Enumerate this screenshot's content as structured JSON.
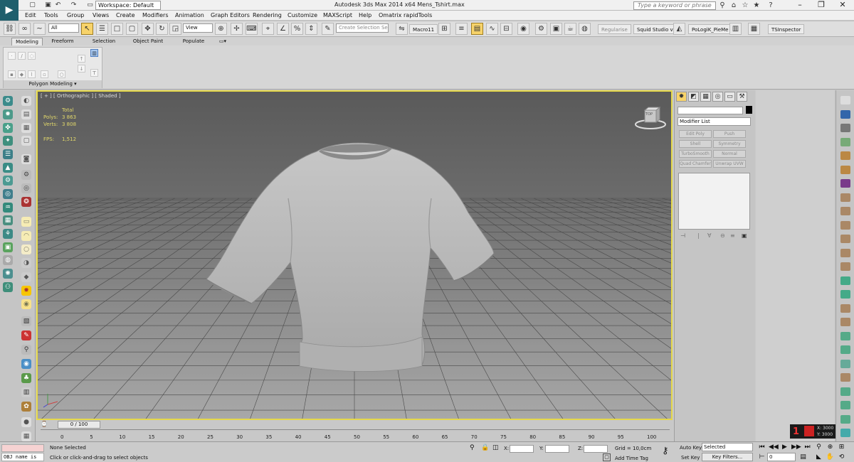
{
  "title_bar": {
    "app_title": "Autodesk 3ds Max  2014 x64     Mens_Tshirt.max",
    "workspace": "Workspace: Default",
    "search_placeholder": "Type a keyword or phrase"
  },
  "menu": [
    "Edit",
    "Tools",
    "Group",
    "Views",
    "Create",
    "Modifiers",
    "Animation",
    "Graph Editors",
    "Rendering",
    "Customize",
    "MAXScript",
    "Help",
    "Omatrix",
    "rapidTools"
  ],
  "toolbar": {
    "filter": "All",
    "ref_coord": "View",
    "selection_set_placeholder": "Create Selection Se",
    "macro": "Macro11",
    "regularise": "Regularise",
    "squid": "Squid Studio v",
    "polylogik": "PoLogiK_PieMe",
    "tsinspector": "TSInspector"
  },
  "ribbon": {
    "tabs": [
      "Modeling",
      "Freeform",
      "Selection",
      "Object Paint",
      "Populate"
    ],
    "active_tab": "Modeling",
    "panel_label": "Polygon Modeling ▾"
  },
  "viewport": {
    "label": "[ + ] [ Orthographic ] [ Shaded ]",
    "stats": {
      "header": "Total",
      "polys_label": "Polys:",
      "polys_value": "3 863",
      "verts_label": "Verts:",
      "verts_value": "3 808",
      "fps_label": "FPS:",
      "fps_value": "1,512"
    },
    "viewcube": "TOP"
  },
  "command_panel": {
    "modifier_list": "Modifier List",
    "modifier_buttons": [
      "Edit Poly",
      "Push",
      "Shell",
      "Symmetry",
      "TurboSmooth",
      "Normal",
      "Quad Chamfer",
      "Unwrap UVW"
    ]
  },
  "timeline": {
    "frame": "0 / 100",
    "ticks": [
      "0",
      "5",
      "10",
      "15",
      "20",
      "25",
      "30",
      "35",
      "40",
      "45",
      "50",
      "55",
      "60",
      "65",
      "70",
      "75",
      "80",
      "85",
      "90",
      "95",
      "100"
    ]
  },
  "status": {
    "maxscript_text": "OBJ name is",
    "selection": "None Selected",
    "prompt": "Click or click-and-drag to select objects",
    "x_label": "X:",
    "y_label": "Y:",
    "z_label": "Z:",
    "grid": "Grid = 10,0cm",
    "add_time_tag": "Add Time Tag",
    "auto_key": "Auto Key",
    "set_key": "Set Key",
    "selected": "Selected",
    "key_filters": "Key Filters...",
    "frame_value": "0",
    "tsi_x": "X: 3000",
    "tsi_y": "Y: 3000",
    "tsi_count": "1"
  }
}
